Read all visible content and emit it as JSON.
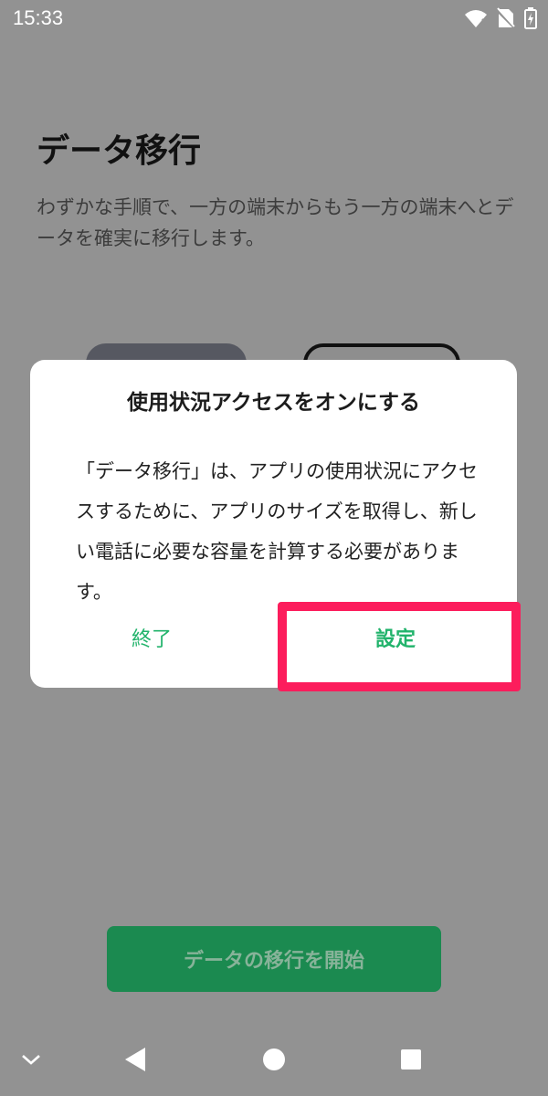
{
  "status_bar": {
    "time": "15:33",
    "icons": [
      "wifi-icon",
      "no-sim-icon",
      "battery-charging-icon"
    ]
  },
  "page": {
    "title": "データ移行",
    "description": "わずかな手順で、一方の端末からもう一方の端末へとデータを確実に移行します。",
    "start_button_label": "データの移行を開始"
  },
  "dialog": {
    "title": "使用状況アクセスをオンにする",
    "body": "「データ移行」は、アプリの使用状況にアクセスするために、アプリのサイズを取得し、新しい電話に必要な容量を計算する必要があります。",
    "end_label": "終了",
    "settings_label": "設定"
  },
  "nav_bar": {
    "icons": [
      "chevron-down-icon",
      "back-icon",
      "home-icon",
      "recents-icon"
    ]
  },
  "colors": {
    "accent_green": "#21b36b",
    "primary_button": "#1b8a50",
    "highlight": "#fc1d5c",
    "scrim_background": "#929292"
  }
}
